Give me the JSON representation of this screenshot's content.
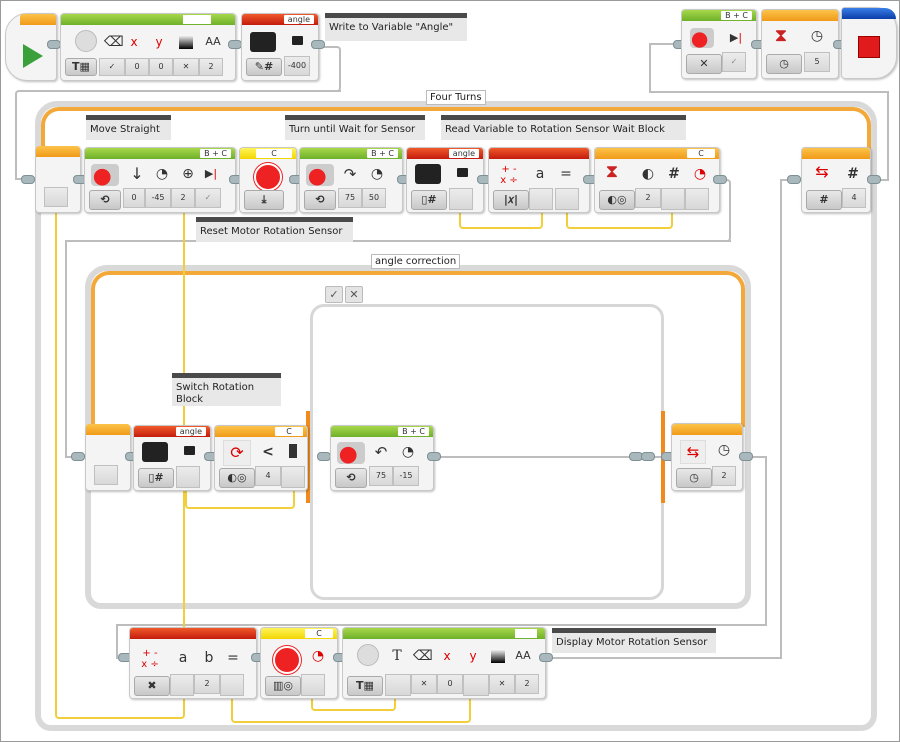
{
  "comments": {
    "write_variable": "Write to Variable \"Angle\"",
    "move_straight": "Move Straight",
    "turn_until": "Turn until Wait for Sensor",
    "read_variable": "Read Variable to Rotation Sensor Wait Block",
    "reset_motor": "Reset Motor Rotation Sensor",
    "switch_rotation": "Switch Rotation Block",
    "display_motor": "Display Motor Rotation Sensor"
  },
  "loops": {
    "outer_label": "Four Turns",
    "inner_label": "angle correction"
  },
  "switch": {
    "true_tab": "✓",
    "false_tab": "✕"
  },
  "blocks": {
    "display_top": {
      "mode": "T",
      "params": [
        "✓",
        "0",
        "0",
        "✕",
        "2"
      ]
    },
    "write_var_top": {
      "name": "angle",
      "value": "-400"
    },
    "stop_motor_top": {
      "port": "B + C",
      "mode": "✕",
      "param": "✓"
    },
    "wait_time_top": {
      "value": "5"
    },
    "move_straight": {
      "port": "B + C",
      "params": [
        "0",
        "-45",
        "2",
        "✓"
      ]
    },
    "reset_rotation": {
      "port": "C"
    },
    "turn_move": {
      "port": "B + C",
      "params": [
        "75",
        "50"
      ]
    },
    "read_var": {
      "name": "angle"
    },
    "math": {
      "op_a": "a",
      "op_eq": "="
    },
    "wait_rotation": {
      "port": "C",
      "value": "2"
    },
    "loop_count": {
      "value": "4"
    },
    "read_var_inner": {
      "name": "angle"
    },
    "switch_rotation": {
      "port": "C",
      "op": "<",
      "value": "4"
    },
    "correction_move": {
      "port": "B + C",
      "params": [
        "75",
        "-15"
      ]
    },
    "inner_loop_end": {
      "value": "2"
    },
    "math_bottom": {
      "a": "a",
      "b": "b",
      "eq": "=",
      "value": "2"
    },
    "rotation_bottom": {
      "port": "C"
    },
    "display_bottom": {
      "params": [
        "✕",
        "0",
        "✕",
        "2"
      ]
    }
  },
  "colors": {
    "loop_orange": "#f3a83a",
    "data_wire": "#f2cf3a",
    "motor_green": "#6fb02a",
    "variable_red": "#c41b0d",
    "sensor_yellow": "#f2d500",
    "stop_blue": "#0c3ea8"
  }
}
